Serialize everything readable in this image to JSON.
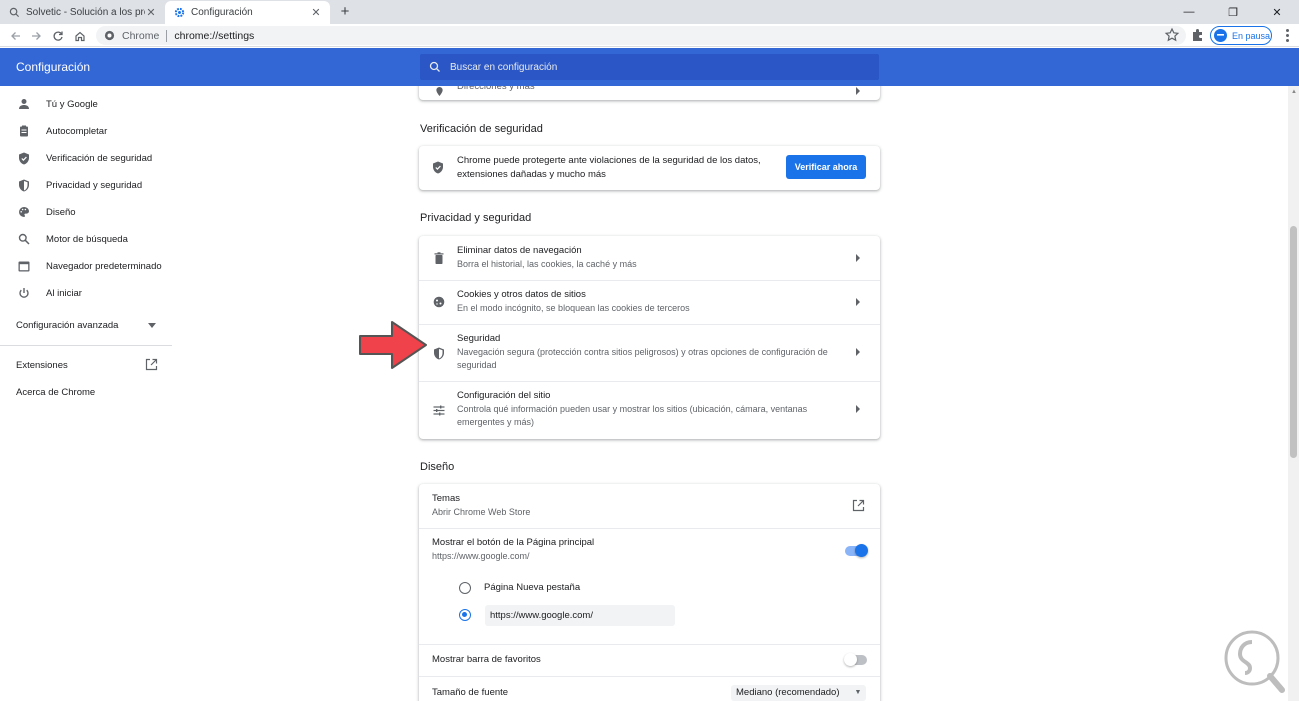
{
  "browser": {
    "tabs": [
      {
        "title": "Solvetic - Solución a los problem",
        "active": false
      },
      {
        "title": "Configuración",
        "active": true
      }
    ],
    "new_tab": "+",
    "window_controls": {
      "minimize": "—",
      "restore": "❐",
      "close": "✕"
    },
    "omnibox": {
      "host": "Chrome",
      "url": "chrome://settings"
    },
    "profile": {
      "label": "En pausa"
    }
  },
  "header": {
    "title": "Configuración",
    "search_placeholder": "Buscar en configuración"
  },
  "sidebar": {
    "items": [
      {
        "label": "Tú y Google",
        "icon": "person-icon"
      },
      {
        "label": "Autocompletar",
        "icon": "clipboard-icon"
      },
      {
        "label": "Verificación de seguridad",
        "icon": "shield-check-icon"
      },
      {
        "label": "Privacidad y seguridad",
        "icon": "shield-icon"
      },
      {
        "label": "Diseño",
        "icon": "palette-icon"
      },
      {
        "label": "Motor de búsqueda",
        "icon": "search-icon"
      },
      {
        "label": "Navegador predeterminado",
        "icon": "browser-icon"
      },
      {
        "label": "Al iniciar",
        "icon": "power-icon"
      }
    ],
    "advanced": "Configuración avanzada",
    "extensions": "Extensiones",
    "about": "Acerca de Chrome"
  },
  "main": {
    "partial_row": "Direcciones y más",
    "safety_check": {
      "title": "Verificación de seguridad",
      "text_line1": "Chrome puede protegerte ante violaciones de la seguridad de los datos,",
      "text_line2": "extensiones dañadas y mucho más",
      "button": "Verificar ahora"
    },
    "privacy": {
      "title": "Privacidad y seguridad",
      "rows": [
        {
          "title": "Eliminar datos de navegación",
          "sub1": "Borra el historial, las cookies, la caché y más",
          "sub2": "",
          "icon": "trash-icon"
        },
        {
          "title": "Cookies y otros datos de sitios",
          "sub1": "En el modo incógnito, se bloquean las cookies de terceros",
          "sub2": "",
          "icon": "cookie-icon"
        },
        {
          "title": "Seguridad",
          "sub1": "Navegación segura (protección contra sitios peligrosos) y otras opciones de configuración de",
          "sub2": "seguridad",
          "icon": "shield-icon"
        },
        {
          "title": "Configuración del sitio",
          "sub1": "Controla qué información pueden usar y mostrar los sitios (ubicación, cámara, ventanas",
          "sub2": "emergentes y más)",
          "icon": "tune-icon"
        }
      ]
    },
    "appearance": {
      "title": "Diseño",
      "themes_title": "Temas",
      "themes_sub": "Abrir Chrome Web Store",
      "home_title": "Mostrar el botón de la Página principal",
      "home_sub": "https://www.google.com/",
      "home_enabled": true,
      "radio_new_tab": "Página Nueva pestaña",
      "radio_url_value": "https://www.google.com/",
      "bookmarks_title": "Mostrar barra de favoritos",
      "bookmarks_enabled": false,
      "font_size_title": "Tamaño de fuente",
      "font_size_value": "Mediano (recomendado)"
    }
  },
  "colors": {
    "header_blue": "#3367d6",
    "accent": "#1a73e8",
    "annotation_arrow": "#f0424a"
  }
}
